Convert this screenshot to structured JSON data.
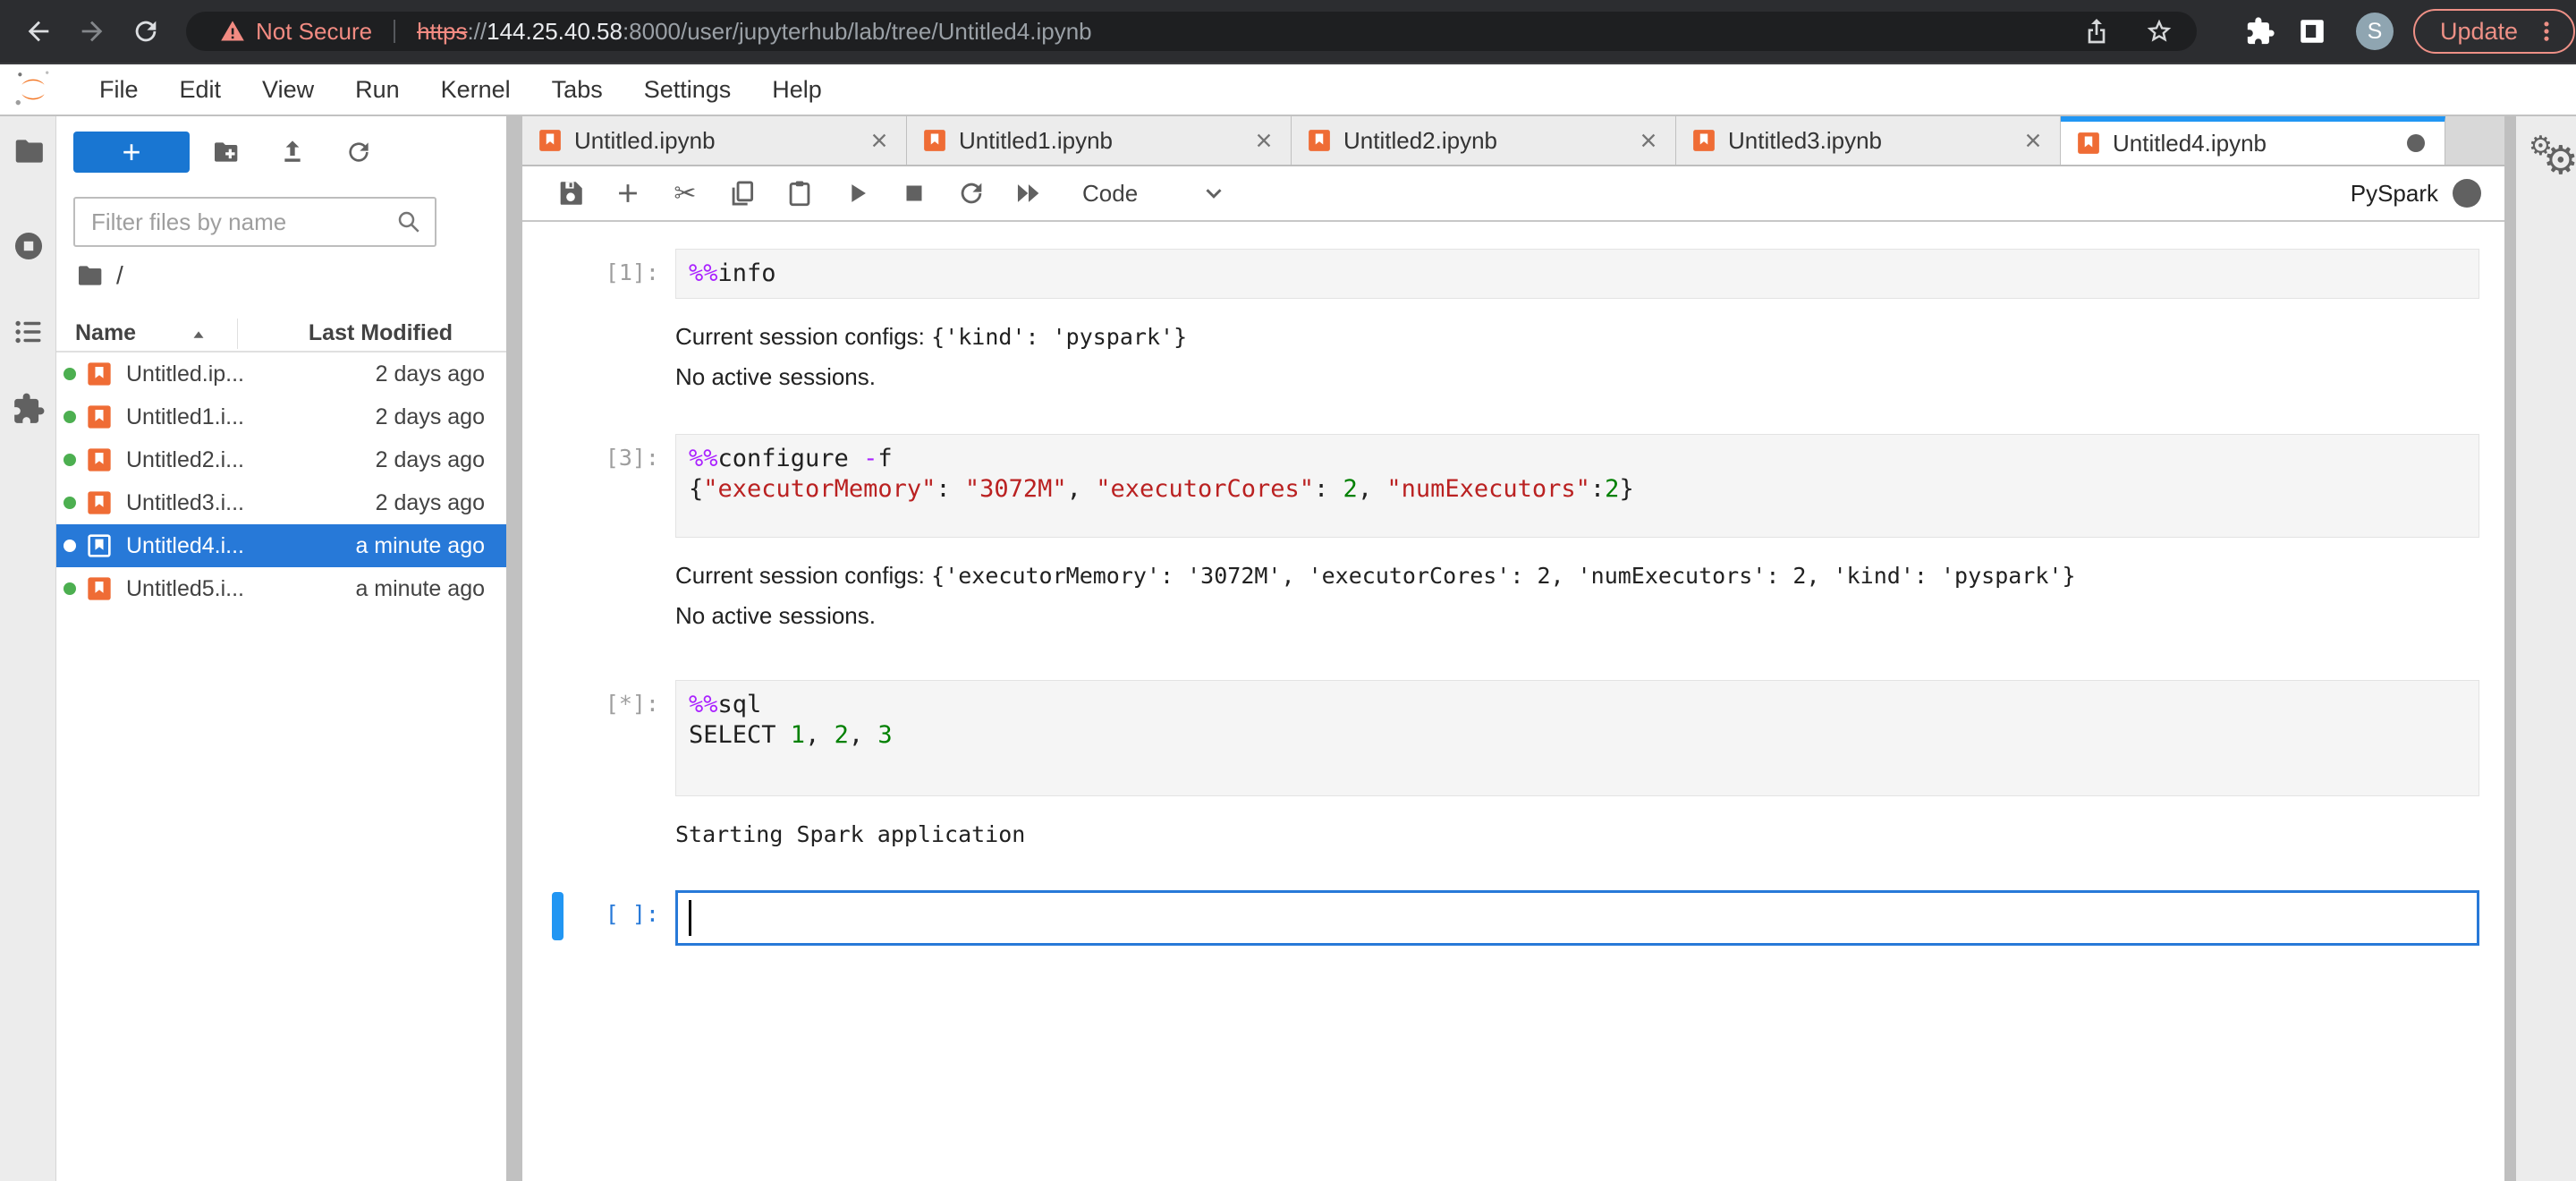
{
  "browser": {
    "not_secure_label": "Not Secure",
    "url_scheme": "https",
    "url_separator": "://",
    "url_host": "144.25.40.58",
    "url_path": ":8000/user/jupyterhub/lab/tree/Untitled4.ipynb",
    "avatar_letter": "S",
    "update_label": "Update"
  },
  "menu": {
    "items": [
      "File",
      "Edit",
      "View",
      "Run",
      "Kernel",
      "Tabs",
      "Settings",
      "Help"
    ]
  },
  "activity_bar": {
    "icons": [
      "folder-icon",
      "running-kernels-icon",
      "table-of-contents-icon",
      "extensions-icon"
    ]
  },
  "filebrowser": {
    "new_launcher_label": "+",
    "action_icons": [
      "new-folder-icon",
      "upload-icon",
      "refresh-icon"
    ],
    "filter_placeholder": "Filter files by name",
    "breadcrumb_root": "/",
    "columns": {
      "name": "Name",
      "modified": "Last Modified"
    },
    "rows": [
      {
        "name": "Untitled.ip...",
        "modified": "2 days ago",
        "selected": false
      },
      {
        "name": "Untitled1.i...",
        "modified": "2 days ago",
        "selected": false
      },
      {
        "name": "Untitled2.i...",
        "modified": "2 days ago",
        "selected": false
      },
      {
        "name": "Untitled3.i...",
        "modified": "2 days ago",
        "selected": false
      },
      {
        "name": "Untitled4.i...",
        "modified": "a minute ago",
        "selected": true
      },
      {
        "name": "Untitled5.i...",
        "modified": "a minute ago",
        "selected": false
      }
    ]
  },
  "dock": {
    "tabs": [
      {
        "label": "Untitled.ipynb",
        "active": false,
        "dirty": false
      },
      {
        "label": "Untitled1.ipynb",
        "active": false,
        "dirty": false
      },
      {
        "label": "Untitled2.ipynb",
        "active": false,
        "dirty": false
      },
      {
        "label": "Untitled3.ipynb",
        "active": false,
        "dirty": false
      },
      {
        "label": "Untitled4.ipynb",
        "active": true,
        "dirty": true
      }
    ],
    "toolbar": {
      "icons": [
        "save-icon",
        "add-cell-icon",
        "cut-icon",
        "copy-icon",
        "paste-icon",
        "run-icon",
        "stop-icon",
        "restart-icon",
        "fast-forward-icon"
      ],
      "cell_type_label": "Code",
      "kernel_name": "PySpark",
      "kernel_status": "busy"
    }
  },
  "notebook": {
    "cells": [
      {
        "prompt": "[1]:",
        "active": false,
        "extra_bottom": 0,
        "source": [
          [
            {
              "c": "magic",
              "v": "%%"
            },
            {
              "c": "plain",
              "v": "info"
            }
          ]
        ],
        "outputs": [
          [
            {
              "f": "sans",
              "v": "Current session configs: "
            },
            {
              "f": "mono",
              "v": "{'kind': 'pyspark'}"
            }
          ],
          [
            {
              "f": "sans",
              "v": "No active sessions."
            }
          ]
        ]
      },
      {
        "prompt": "[3]:",
        "active": false,
        "extra_bottom": 26,
        "source": [
          [
            {
              "c": "magic",
              "v": "%%"
            },
            {
              "c": "plain",
              "v": "configure "
            },
            {
              "c": "magic",
              "v": "-"
            },
            {
              "c": "plain",
              "v": "f"
            }
          ],
          [
            {
              "c": "plain",
              "v": "{"
            },
            {
              "c": "str",
              "v": "\"executorMemory\""
            },
            {
              "c": "plain",
              "v": ": "
            },
            {
              "c": "str",
              "v": "\"3072M\""
            },
            {
              "c": "plain",
              "v": ", "
            },
            {
              "c": "str",
              "v": "\"executorCores\""
            },
            {
              "c": "plain",
              "v": ": "
            },
            {
              "c": "num",
              "v": "2"
            },
            {
              "c": "plain",
              "v": ", "
            },
            {
              "c": "str",
              "v": "\"numExecutors\""
            },
            {
              "c": "plain",
              "v": ":"
            },
            {
              "c": "num",
              "v": "2"
            },
            {
              "c": "plain",
              "v": "}"
            }
          ]
        ],
        "outputs": [
          [
            {
              "f": "sans",
              "v": "Current session configs: "
            },
            {
              "f": "mono",
              "v": "{'executorMemory': '3072M', 'executorCores': 2, 'numExecutors': 2, 'kind': 'pyspark'}"
            }
          ],
          [
            {
              "f": "sans",
              "v": "No active sessions."
            }
          ]
        ]
      },
      {
        "prompt": "[*]:",
        "active": false,
        "extra_bottom": 40,
        "source": [
          [
            {
              "c": "magic",
              "v": "%%"
            },
            {
              "c": "plain",
              "v": "sql"
            }
          ],
          [
            {
              "c": "plain",
              "v": "SELECT "
            },
            {
              "c": "num",
              "v": "1"
            },
            {
              "c": "plain",
              "v": ", "
            },
            {
              "c": "num",
              "v": "2"
            },
            {
              "c": "plain",
              "v": ", "
            },
            {
              "c": "num",
              "v": "3"
            }
          ]
        ],
        "outputs": [
          [
            {
              "f": "mono",
              "v": "Starting Spark application"
            }
          ]
        ]
      },
      {
        "prompt": "[ ]:",
        "active": true,
        "extra_bottom": 0,
        "source": [
          []
        ],
        "outputs": []
      }
    ]
  },
  "right_bar": {
    "icon": "property-inspector-gears-icon"
  },
  "colors": {
    "accent_blue": "#1976d2",
    "selection_blue": "#2779d8",
    "active_cell_border": "#2779d8",
    "warning_salmon": "#f28b82",
    "update_salmon": "#ee9086",
    "magic_purple": "#AA22FF",
    "string_red": "#BA2121",
    "number_green": "#008000",
    "notebook_orange": "#EF6C35",
    "kernel_busy_gray": "#616161",
    "running_dot_green": "#4caf50"
  }
}
